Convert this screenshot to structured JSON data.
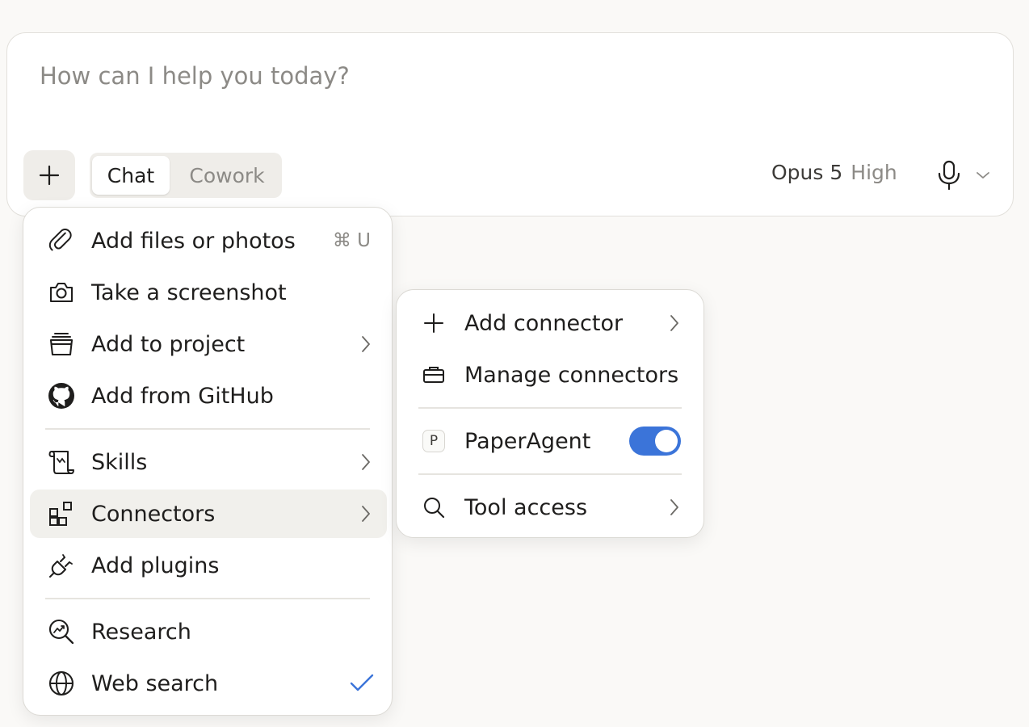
{
  "composer": {
    "placeholder": "How can I help you today?",
    "modes": [
      "Chat",
      "Cowork"
    ],
    "selected_mode": "Chat",
    "model": "Opus 5",
    "effort": "High"
  },
  "add_menu": {
    "items": [
      {
        "label": "Add files or photos",
        "icon": "paperclip-icon",
        "shortcut": "⌘ U"
      },
      {
        "label": "Take a screenshot",
        "icon": "camera-icon"
      },
      {
        "label": "Add to project",
        "icon": "project-icon",
        "has_submenu": true
      },
      {
        "label": "Add from GitHub",
        "icon": "github-icon"
      },
      {
        "label": "Skills",
        "icon": "scroll-icon",
        "has_submenu": true
      },
      {
        "label": "Connectors",
        "icon": "connectors-icon",
        "has_submenu": true,
        "active": true
      },
      {
        "label": "Add plugins",
        "icon": "plug-icon"
      },
      {
        "label": "Research",
        "icon": "research-icon"
      },
      {
        "label": "Web search",
        "icon": "globe-icon",
        "checked": true
      }
    ]
  },
  "connectors_menu": {
    "items": [
      {
        "label": "Add connector",
        "icon": "plus-icon",
        "has_submenu": true
      },
      {
        "label": "Manage connectors",
        "icon": "briefcase-icon"
      },
      {
        "label": "PaperAgent",
        "badge": "P",
        "enabled": true
      },
      {
        "label": "Tool access",
        "icon": "search-icon",
        "has_submenu": true
      }
    ]
  },
  "colors": {
    "accent": "#3b74d9",
    "background": "#faf9f7",
    "active_row": "#f1f0ec"
  }
}
